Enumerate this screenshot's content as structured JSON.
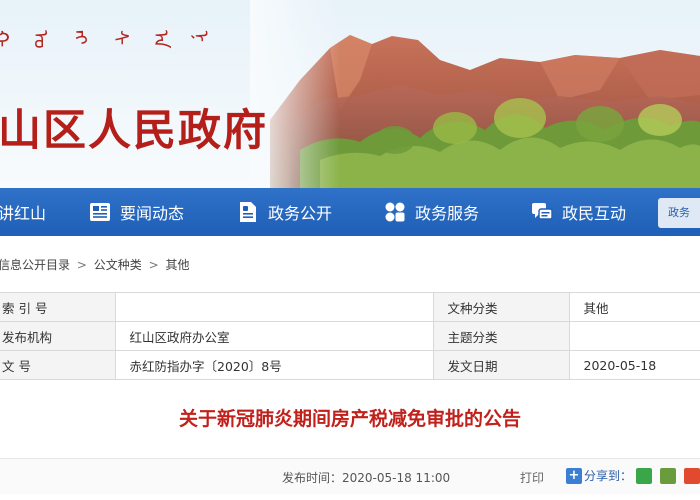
{
  "header": {
    "mongolian_script": [
      "ᠬ",
      "ᠣ",
      "ᠩ",
      "ᠰ",
      "ᠠ",
      "ᠨ"
    ],
    "site_title": "山区人民政府"
  },
  "nav": {
    "items": [
      {
        "label": "讲红山",
        "icon": "landmark-icon"
      },
      {
        "label": "要闻动态",
        "icon": "newspaper-icon"
      },
      {
        "label": "政务公开",
        "icon": "document-icon"
      },
      {
        "label": "政务服务",
        "icon": "service-icon"
      },
      {
        "label": "政民互动",
        "icon": "chat-icon"
      }
    ],
    "extra_label": "政务"
  },
  "breadcrumb": [
    "信息公开目录",
    "公文种类",
    "其他"
  ],
  "breadcrumb_sep": ">",
  "info_table": {
    "rows": [
      {
        "label1": "索 引 号",
        "value1": "",
        "label2": "文种分类",
        "value2": "其他"
      },
      {
        "label1": "发布机构",
        "value1": "红山区政府办公室",
        "label2": "主题分类",
        "value2": ""
      },
      {
        "label1": "文      号",
        "value1": "赤红防指办字〔2020〕8号",
        "label2": "发文日期",
        "value2": "2020-05-18"
      }
    ]
  },
  "article": {
    "title": "关于新冠肺炎期间房产税减免审批的公告"
  },
  "meta": {
    "publish_time": "发布时间：2020-05-18 11:00",
    "print_label": "打印",
    "share_label": "分享到：",
    "share_plus": "+"
  },
  "colors": {
    "nav_blue": "#1f5fb7",
    "title_red": "#c1201b",
    "site_title_red": "#b51f1a"
  }
}
